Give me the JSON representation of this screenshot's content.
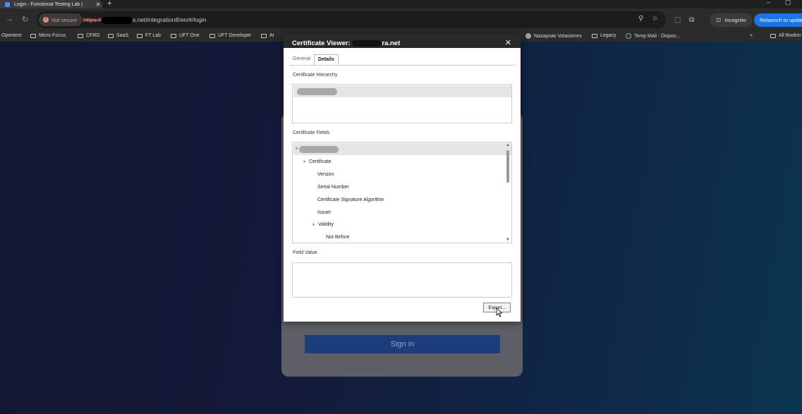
{
  "browser": {
    "tab": {
      "title": "Login - Functional Testing Lab |",
      "close": "✕"
    },
    "new_tab": "+",
    "window_controls": {
      "minimize": "–",
      "restore": "▢"
    },
    "security_chip": "Not secure",
    "url": {
      "scheme": "https://",
      "host_suffix": "a.net",
      "path": "/integration8/en/#/login"
    },
    "incognito_label": "Incognito",
    "relaunch_label": "Relaunch to updat"
  },
  "bookmarks": [
    {
      "label": "Opentext",
      "icon": "none"
    },
    {
      "label": "Micro Focus",
      "icon": "folder"
    },
    {
      "label": "CFRD",
      "icon": "folder"
    },
    {
      "label": "SaaS",
      "icon": "folder"
    },
    {
      "label": "FT Lab",
      "icon": "folder"
    },
    {
      "label": "UFT One",
      "icon": "folder"
    },
    {
      "label": "UFT Developer",
      "icon": "folder"
    },
    {
      "label": "AI",
      "icon": "folder"
    },
    {
      "label": "Nazapoas Votaciones",
      "icon": "globe"
    },
    {
      "label": "Legacy",
      "icon": "folder"
    },
    {
      "label": "Temp Mail - Dispos...",
      "icon": "mail"
    },
    {
      "label": "All Bookm",
      "icon": "folder"
    }
  ],
  "bookmarks_overflow": "»",
  "certificate_viewer": {
    "title_prefix": "Certificate Viewer: ",
    "title_suffix": "ra.net",
    "close": "✕",
    "tabs": [
      "General",
      "Details"
    ],
    "active_tab": "Details",
    "hierarchy_label": "Certificate Hierarchy",
    "fields_label": "Certificate Fields",
    "fields_tree": [
      {
        "label": "Certificate",
        "expanded": true
      },
      {
        "label": "Version"
      },
      {
        "label": "Serial Number"
      },
      {
        "label": "Certificate Signature Algorithm"
      },
      {
        "label": "Issuer"
      },
      {
        "label": "Validity",
        "expanded": true
      },
      {
        "label": "Not Before"
      }
    ],
    "field_value_label": "Field Value",
    "field_value": "",
    "export_button": "Export..."
  },
  "login": {
    "signin_button": "Sign in"
  }
}
